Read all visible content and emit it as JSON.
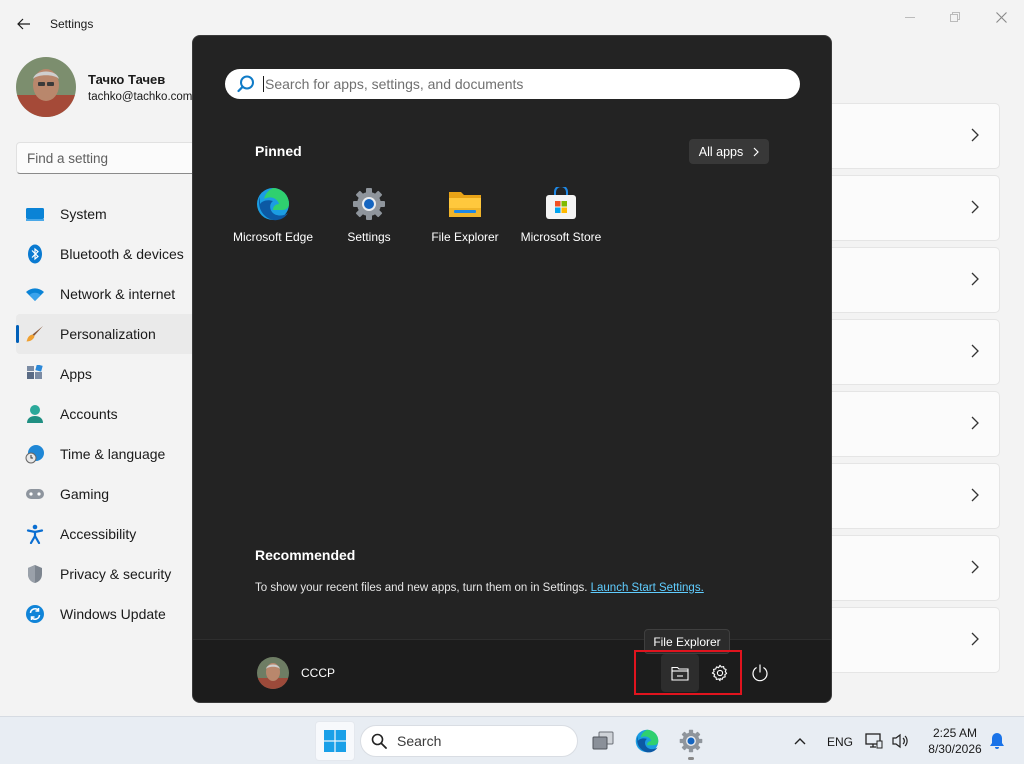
{
  "settings": {
    "title": "Settings",
    "user": {
      "name": "Тачко Тачев",
      "email": "tachko@tachko.com"
    },
    "search_placeholder": "Find a setting",
    "nav": [
      {
        "label": "System",
        "icon": "monitor-icon"
      },
      {
        "label": "Bluetooth & devices",
        "icon": "bluetooth-icon"
      },
      {
        "label": "Network & internet",
        "icon": "wifi-icon"
      },
      {
        "label": "Personalization",
        "icon": "paintbrush-icon",
        "selected": true
      },
      {
        "label": "Apps",
        "icon": "apps-icon"
      },
      {
        "label": "Accounts",
        "icon": "person-icon"
      },
      {
        "label": "Time & language",
        "icon": "globe-clock-icon"
      },
      {
        "label": "Gaming",
        "icon": "gamepad-icon"
      },
      {
        "label": "Accessibility",
        "icon": "accessibility-icon"
      },
      {
        "label": "Privacy & security",
        "icon": "shield-icon"
      },
      {
        "label": "Windows Update",
        "icon": "update-icon"
      }
    ]
  },
  "start_menu": {
    "search_placeholder": "Search for apps, settings, and documents",
    "pinned_heading": "Pinned",
    "all_apps_label": "All apps",
    "pinned": [
      {
        "label": "Microsoft Edge",
        "icon": "edge-icon"
      },
      {
        "label": "Settings",
        "icon": "settings-gear-icon"
      },
      {
        "label": "File Explorer",
        "icon": "folder-icon"
      },
      {
        "label": "Microsoft Store",
        "icon": "store-icon"
      }
    ],
    "recommended_heading": "Recommended",
    "recommended_text": "To show your recent files and new apps, turn them on in Settings.",
    "recommended_link": "Launch Start Settings.",
    "user_name": "CCCP",
    "tooltip": "File Explorer"
  },
  "taskbar": {
    "search_label": "Search",
    "language": "ENG",
    "time": "2:25 AM",
    "date": "8/30/2026"
  },
  "colors": {
    "accent": "#005fb8",
    "start_bg": "#232323",
    "link": "#60cdff",
    "highlight": "#e0141e"
  }
}
